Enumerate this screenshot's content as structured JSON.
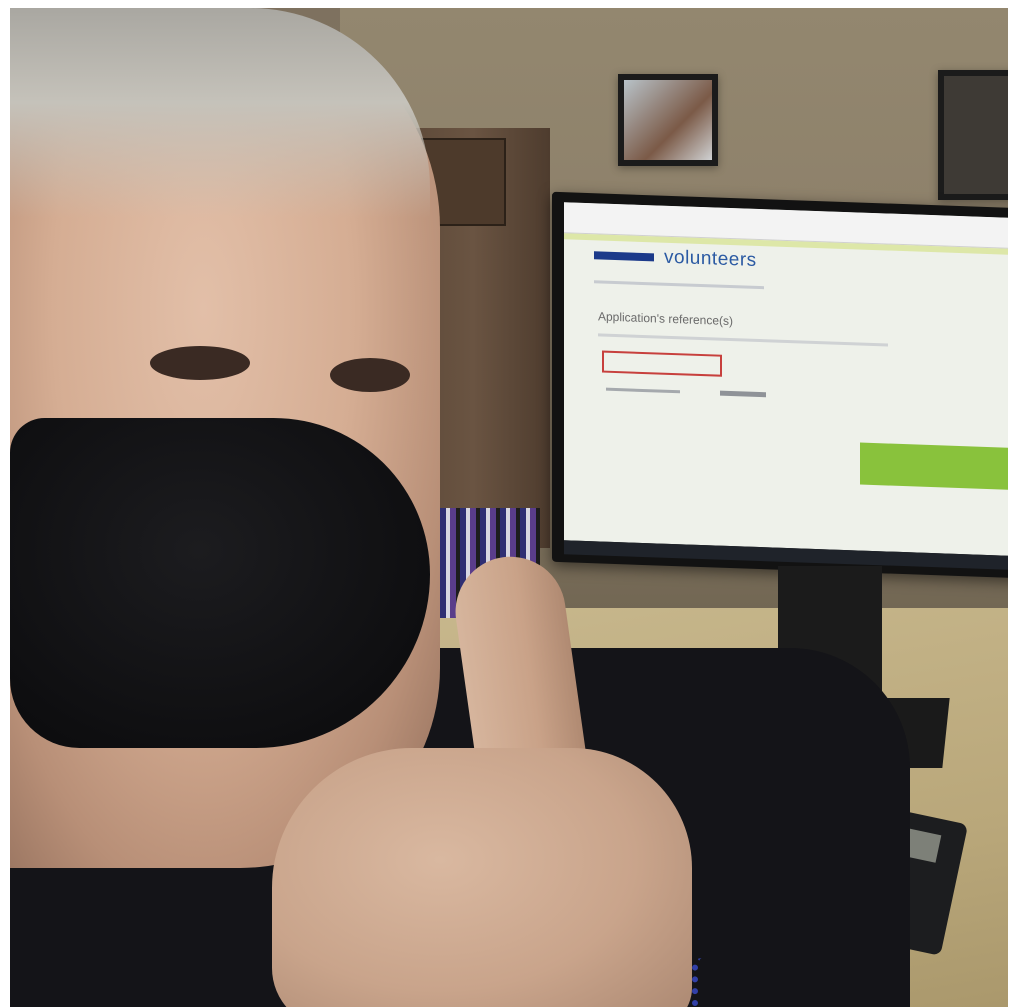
{
  "photo": {
    "monitor_screen": {
      "site_title": "volunteers",
      "section_title": "Application's reference(s)"
    }
  },
  "colors": {
    "site_title": "#2b5aa3",
    "logo": "#1c3a8a",
    "submit_button": "#89c23c",
    "radio_outline": "#c7403d"
  }
}
